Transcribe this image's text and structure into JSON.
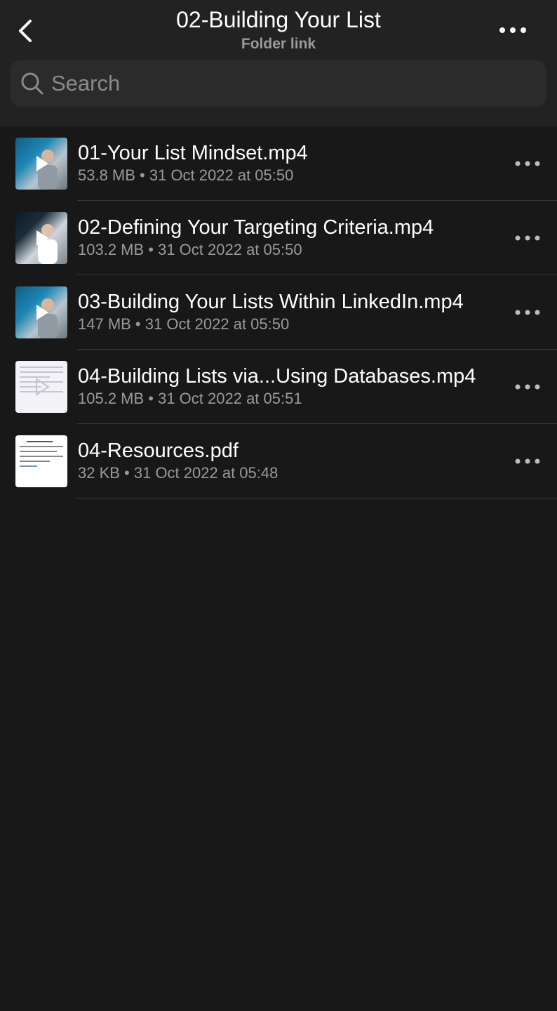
{
  "header": {
    "title": "02-Building Your List",
    "subtitle": "Folder link"
  },
  "search": {
    "placeholder": "Search"
  },
  "files": [
    {
      "name": "01-Your List Mindset.mp4",
      "meta": "53.8 MB • 31 Oct 2022 at 05:50",
      "thumbnail": "video"
    },
    {
      "name": "02-Defining Your Targeting Criteria.mp4",
      "meta": "103.2 MB • 31 Oct 2022 at 05:50",
      "thumbnail": "video"
    },
    {
      "name": "03-Building Your Lists Within LinkedIn.mp4",
      "meta": "147 MB • 31 Oct 2022 at 05:50",
      "thumbnail": "video"
    },
    {
      "name": "04-Building Lists via...Using Databases.mp4",
      "meta": "105.2 MB • 31 Oct 2022 at 05:51",
      "thumbnail": "video"
    },
    {
      "name": "04-Resources.pdf",
      "meta": "32 KB • 31 Oct 2022 at 05:48",
      "thumbnail": "pdf"
    }
  ],
  "icons": {
    "back": "chevron-left-icon",
    "header_more": "more-horizontal-icon",
    "search": "search-icon",
    "row_more": "more-horizontal-icon",
    "play": "play-icon"
  }
}
